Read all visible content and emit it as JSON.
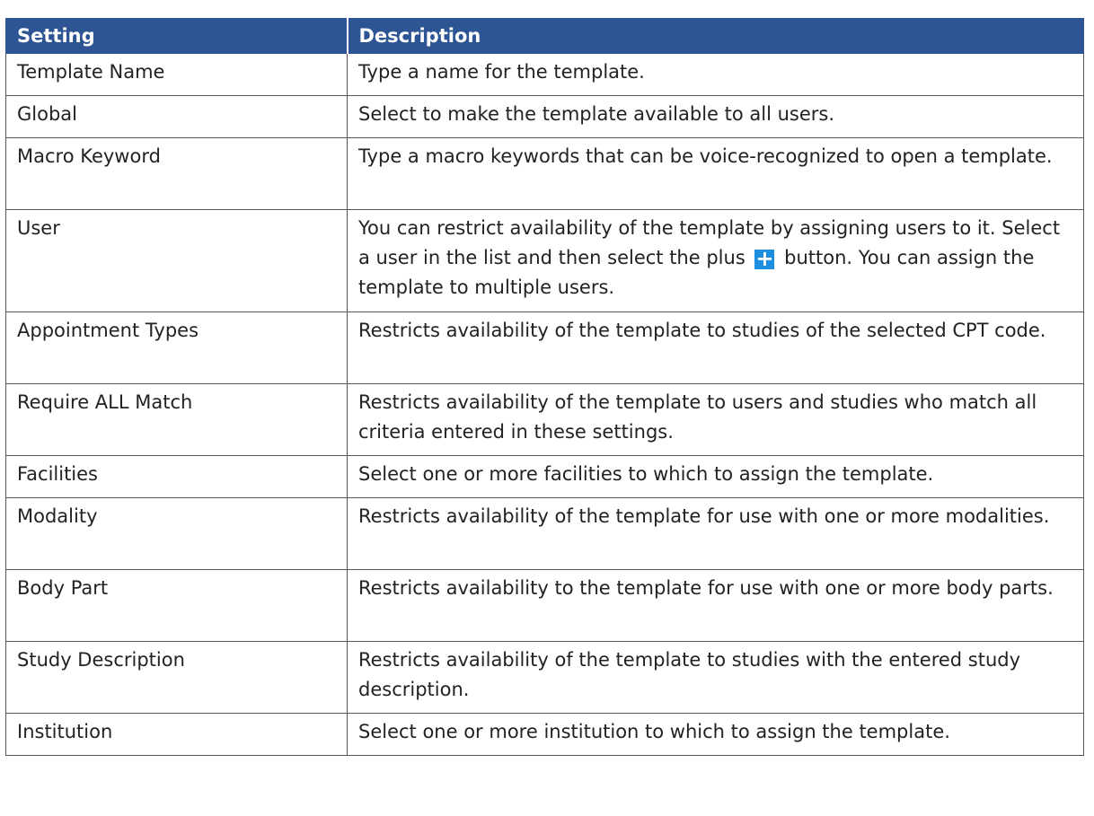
{
  "headers": {
    "setting": "Setting",
    "description": "Description"
  },
  "rows": [
    {
      "setting": "Template Name",
      "description": "Type a name for the template."
    },
    {
      "setting": "Global",
      "description": "Select to make the template available to all users."
    },
    {
      "setting": "Macro Keyword",
      "description": "Type a macro keywords that can be voice-recognized to open a template."
    },
    {
      "setting": "User",
      "description_before_icon": "You can restrict availability of the template by assigning users to it. Select a user in the list and then select the plus",
      "icon": "plus-icon",
      "icon_color": "#1e8fe0",
      "description_after_icon": "button. You can assign the template to multiple users."
    },
    {
      "setting": "Appointment Types",
      "description": "Restricts availability of the template to studies of the selected CPT code."
    },
    {
      "setting": "Require ALL Match",
      "description": "Restricts availability of the template to users and studies who match all criteria entered in these settings."
    },
    {
      "setting": "Facilities",
      "description": "Select one or more facilities to which to assign the template."
    },
    {
      "setting": "Modality",
      "description": "Restricts availability of the template for use with one or more modalities."
    },
    {
      "setting": "Body Part",
      "description": "Restricts availability to the template for use with one or more body parts."
    },
    {
      "setting": "Study Description",
      "description": "Restricts availability of the template to studies with the entered study description."
    },
    {
      "setting": "Institution",
      "description": "Select one or more institution to which to assign the template."
    }
  ],
  "colors": {
    "header_bg": "#2d5493",
    "header_text": "#ffffff",
    "border": "#555555"
  }
}
